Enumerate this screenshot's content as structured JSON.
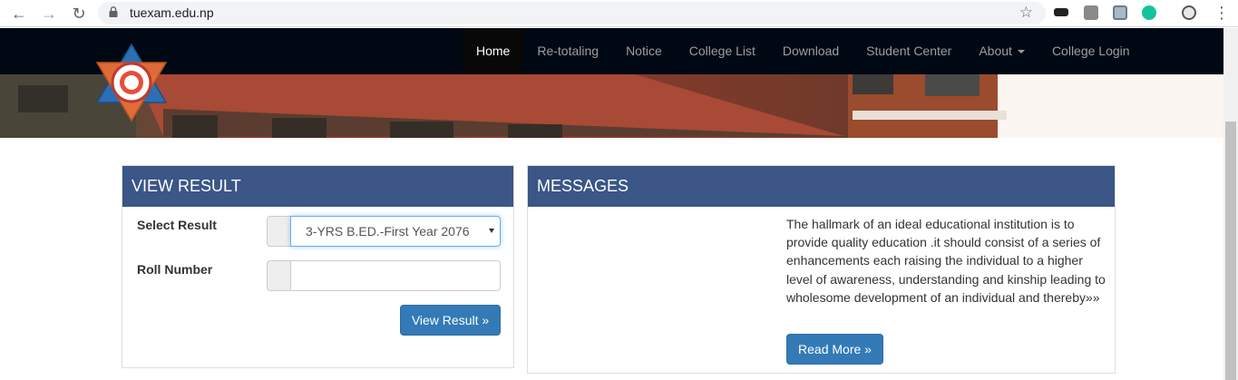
{
  "browser": {
    "url": "tuexam.edu.np",
    "back_icon": "←",
    "forward_icon": "→",
    "reload_icon": "↻",
    "star_icon": "☆",
    "menu_icon": "⋮"
  },
  "nav": {
    "items": [
      "Home",
      "Re-totaling",
      "Notice",
      "College List",
      "Download",
      "Student Center",
      "About",
      "College Login"
    ],
    "active": "Home"
  },
  "view_result": {
    "title": "VIEW RESULT",
    "select_label": "Select Result",
    "selected_value": "3-YRS B.ED.-First Year 2076",
    "roll_label": "Roll Number",
    "roll_value": "",
    "button": "View Result »"
  },
  "messages": {
    "title": "MESSAGES",
    "text": "The hallmark of an ideal educational institution is to provide quality education .it should consist of a series of enhancements each raising the individual to a higher level of awareness, understanding and kinship leading to wholesome development of an individual and thereby»»",
    "button": "Read More »"
  },
  "colors": {
    "nav_bg": "#000814",
    "panel_heading": "#3b5687",
    "button": "#337ab7"
  }
}
